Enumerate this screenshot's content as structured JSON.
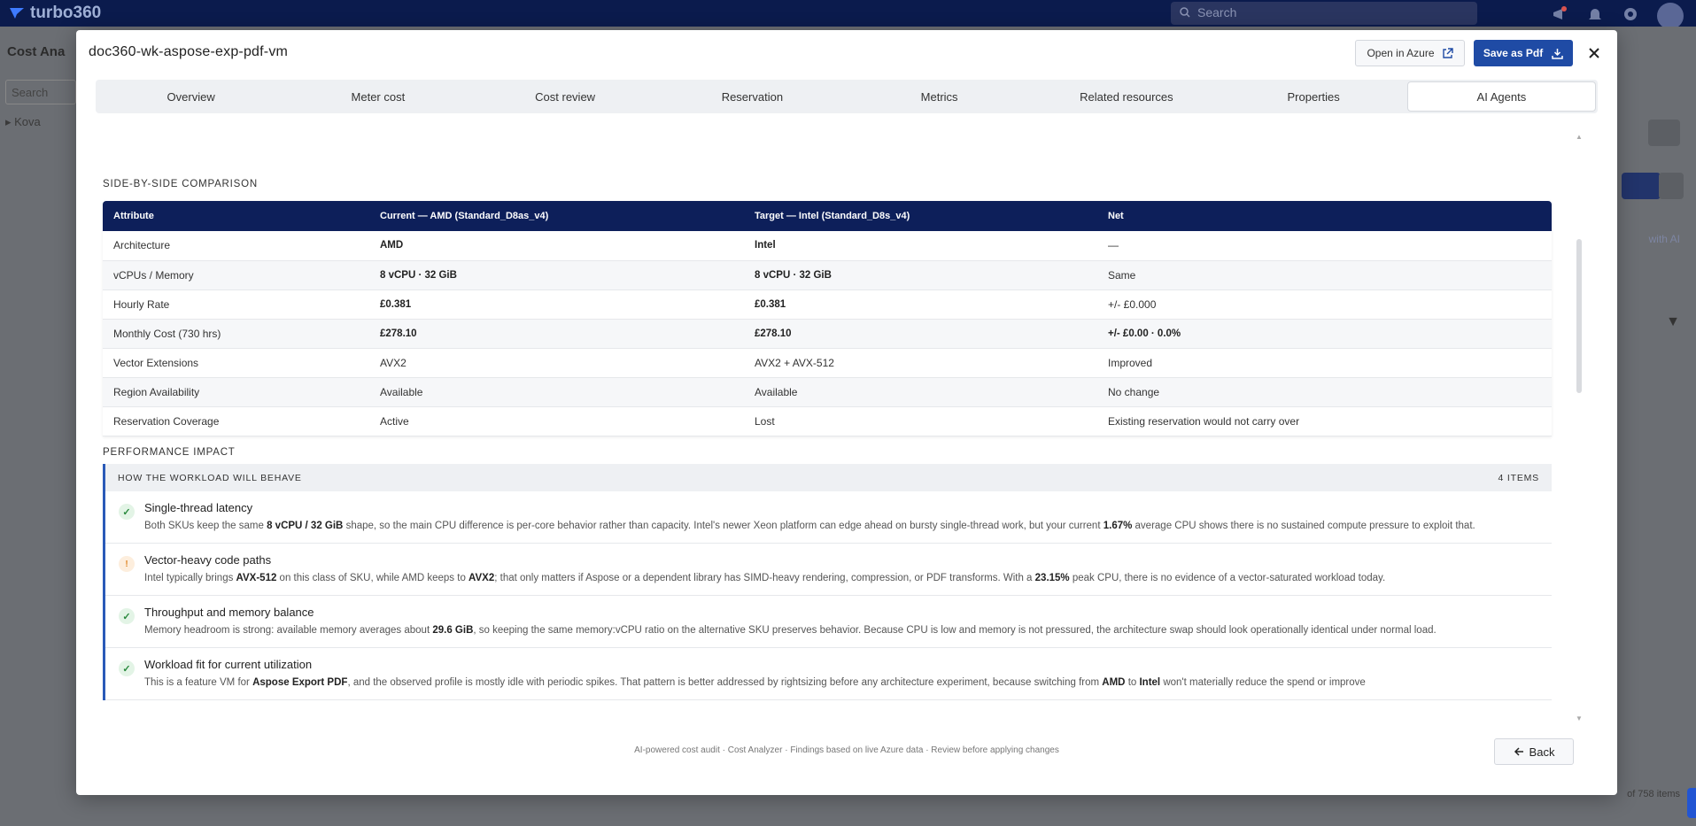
{
  "app": {
    "name": "turbo360",
    "search_placeholder": "Search",
    "bg_title": "Cost Ana",
    "bg_search": "Search",
    "bg_tree_item": "Kova",
    "bg_ai_label": "with AI",
    "bg_items_count": "of 758 items"
  },
  "modal": {
    "title": "doc360-wk-aspose-exp-pdf-vm",
    "open_azure_label": "Open in Azure",
    "save_pdf_label": "Save as Pdf"
  },
  "tabs": [
    {
      "label": "Overview"
    },
    {
      "label": "Meter cost"
    },
    {
      "label": "Cost review"
    },
    {
      "label": "Reservation"
    },
    {
      "label": "Metrics"
    },
    {
      "label": "Related resources"
    },
    {
      "label": "Properties"
    },
    {
      "label": "AI Agents",
      "active": true
    }
  ],
  "comparison": {
    "heading": "SIDE-BY-SIDE COMPARISON",
    "headers": [
      "Attribute",
      "Current — AMD (Standard_D8as_v4)",
      "Target — Intel (Standard_D8s_v4)",
      "Net"
    ],
    "rows": [
      {
        "attribute": "Architecture",
        "current": "AMD",
        "target": "Intel",
        "net": "—",
        "bold": true,
        "net_bold": false
      },
      {
        "attribute": "vCPUs / Memory",
        "current": "8 vCPU · 32 GiB",
        "target": "8 vCPU · 32 GiB",
        "net": "Same",
        "bold": true,
        "net_bold": false
      },
      {
        "attribute": "Hourly Rate",
        "current": "£0.381",
        "target": "£0.381",
        "net": "+/- £0.000",
        "bold": true,
        "net_bold": false
      },
      {
        "attribute": "Monthly Cost (730 hrs)",
        "current": "£278.10",
        "target": "£278.10",
        "net": "+/- £0.00 · 0.0%",
        "bold": true,
        "net_bold": true
      },
      {
        "attribute": "Vector Extensions",
        "current": "AVX2",
        "target": "AVX2 + AVX-512",
        "net": "Improved",
        "bold": false,
        "net_bold": false
      },
      {
        "attribute": "Region Availability",
        "current": "Available",
        "target": "Available",
        "net": "No change",
        "bold": false,
        "net_bold": false
      },
      {
        "attribute": "Reservation Coverage",
        "current": "Active",
        "target": "Lost",
        "net": "Existing reservation would not carry over",
        "bold": false,
        "net_bold": false
      }
    ]
  },
  "performance": {
    "heading": "PERFORMANCE IMPACT",
    "box_title": "HOW THE WORKLOAD WILL BEHAVE",
    "count": "4 ITEMS",
    "items": [
      {
        "status": "ok",
        "title": "Single-thread latency",
        "parts": [
          {
            "t": "Both SKUs keep the same "
          },
          {
            "b": "8 vCPU / 32 GiB"
          },
          {
            "t": " shape, so the main CPU difference is per-core behavior rather than capacity. Intel's newer Xeon platform can edge ahead on bursty single-thread work, but your current "
          },
          {
            "b": "1.67%"
          },
          {
            "t": " average CPU shows there is no sustained compute pressure to exploit that."
          }
        ]
      },
      {
        "status": "warn",
        "title": "Vector-heavy code paths",
        "parts": [
          {
            "t": "Intel typically brings "
          },
          {
            "b": "AVX-512"
          },
          {
            "t": " on this class of SKU, while AMD keeps to "
          },
          {
            "b": "AVX2"
          },
          {
            "t": "; that only matters if Aspose or a dependent library has SIMD-heavy rendering, compression, or PDF transforms. With a "
          },
          {
            "b": "23.15%"
          },
          {
            "t": " peak CPU, there is no evidence of a vector-saturated workload today."
          }
        ]
      },
      {
        "status": "ok",
        "title": "Throughput and memory balance",
        "parts": [
          {
            "t": "Memory headroom is strong: available memory averages about "
          },
          {
            "b": "29.6 GiB"
          },
          {
            "t": ", so keeping the same memory:vCPU ratio on the alternative SKU preserves behavior. Because CPU is low and memory is not pressured, the architecture swap should look operationally identical under normal load."
          }
        ]
      },
      {
        "status": "ok",
        "title": "Workload fit for current utilization",
        "parts": [
          {
            "t": "This is a feature VM for "
          },
          {
            "b": "Aspose Export PDF"
          },
          {
            "t": ", and the observed profile is mostly idle with periodic spikes. That pattern is better addressed by rightsizing before any architecture experiment, because switching from "
          },
          {
            "b": "AMD"
          },
          {
            "t": " to "
          },
          {
            "b": "Intel"
          },
          {
            "t": " won't materially reduce the spend or improve"
          }
        ]
      }
    ]
  },
  "footer": {
    "note": "AI-powered cost audit · Cost Analyzer · Findings based on live Azure data · Review before applying changes",
    "back_label": "Back"
  }
}
